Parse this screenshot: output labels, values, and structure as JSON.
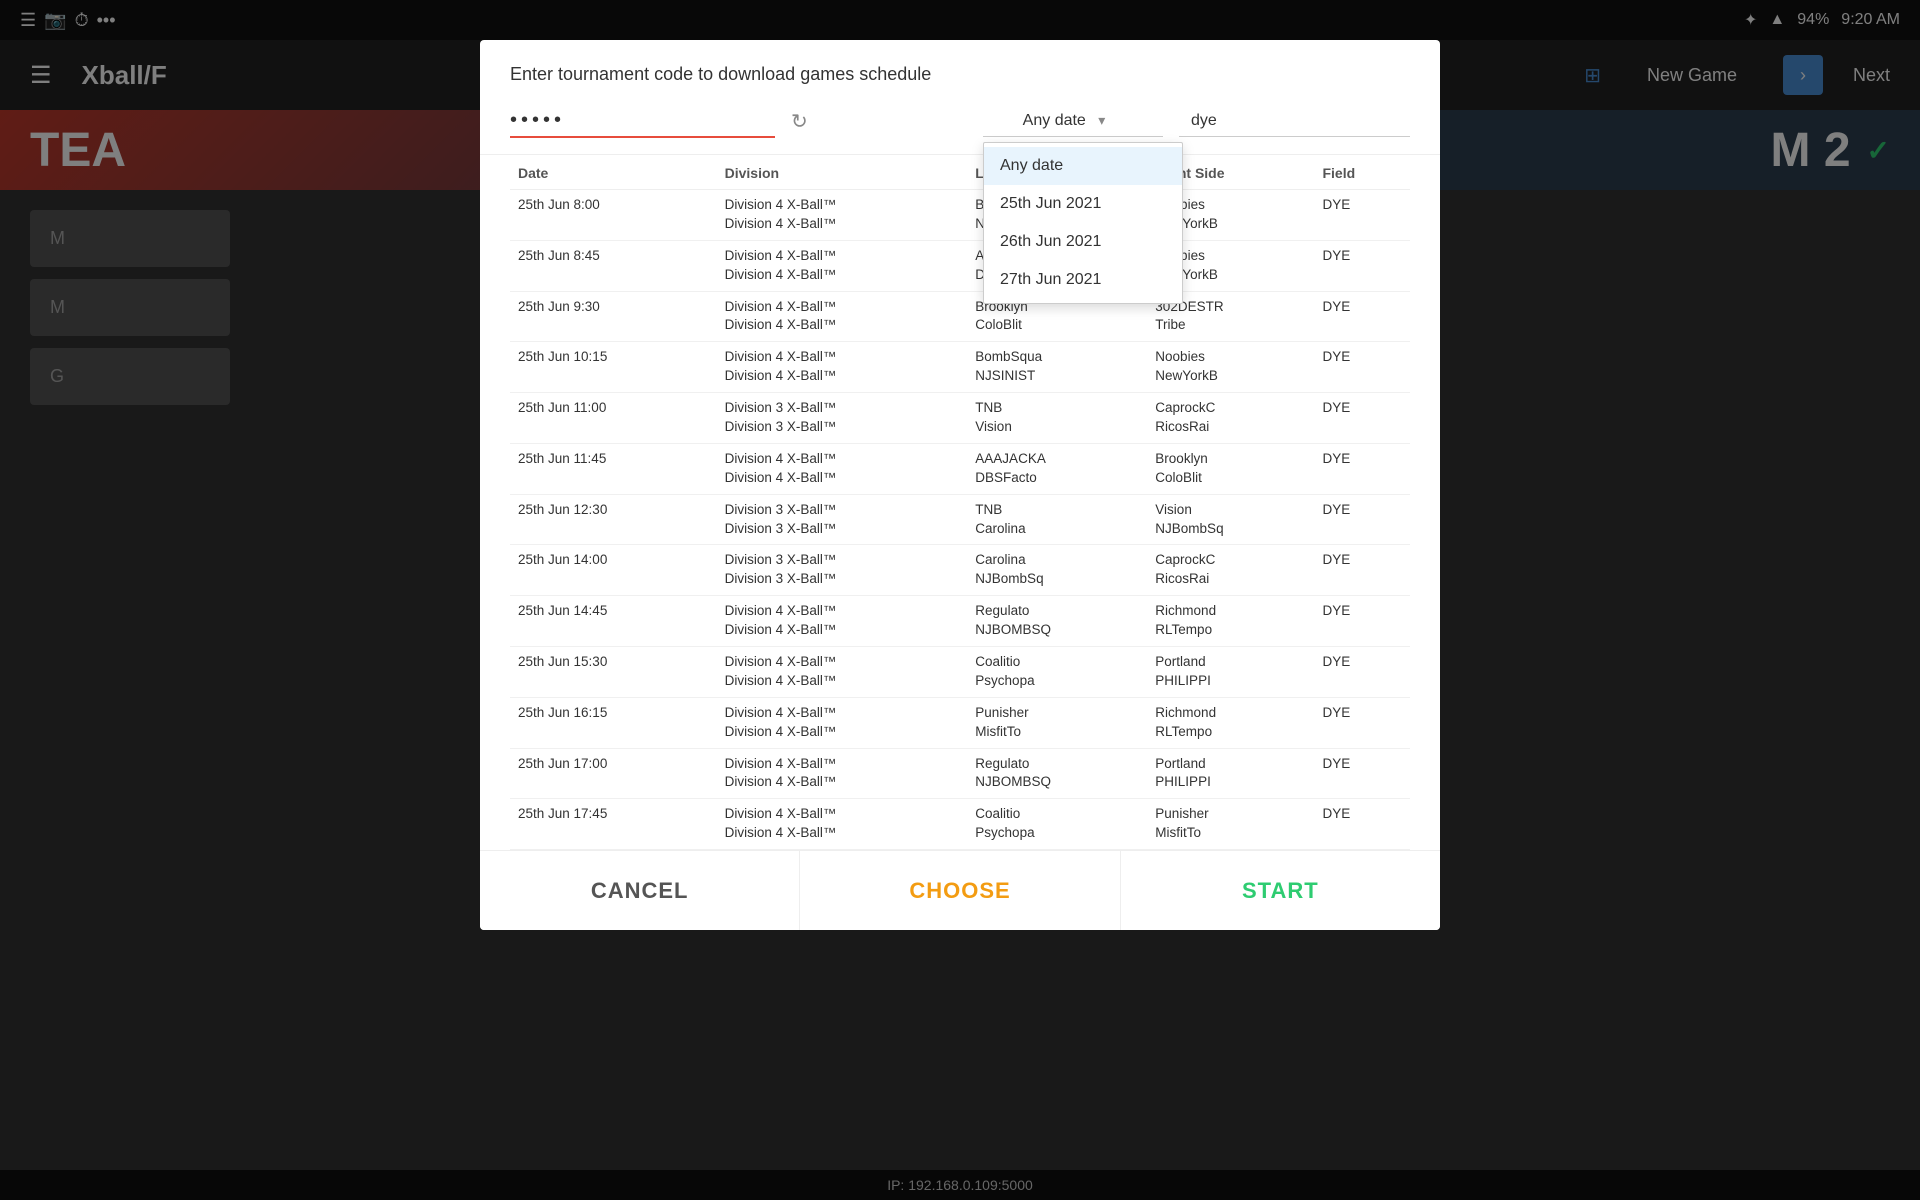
{
  "statusBar": {
    "leftIcons": [
      "☰",
      "📷",
      "⏱",
      "•••"
    ],
    "time": "9:20 AM",
    "battery": "94%",
    "wifi": "WiFi",
    "bluetooth": "BT"
  },
  "header": {
    "title": "Xball/F",
    "newGameLabel": "New Game",
    "nextLabel": "Next"
  },
  "teamBanner": {
    "text": "TEA"
  },
  "modal": {
    "title": "Enter tournament code to download games schedule",
    "codeValue": "•••••",
    "datePlaceholder": "Any date",
    "fieldSearchValue": "dye",
    "dateOptions": [
      "Any date",
      "25th Jun 2021",
      "26th Jun 2021",
      "27th Jun 2021"
    ],
    "selectedDate": "Any date",
    "columns": {
      "date": "Date",
      "division": "Division",
      "leftSide": "Left Side",
      "rightSide": "Right Side",
      "field": "Field"
    },
    "rows": [
      {
        "date": "25th Jun 8:00",
        "div1": "Division 4 X-Ball™",
        "div2": "Division 4 X-Ball™",
        "left1": "BombSqua",
        "left2": "NJSINIST",
        "right1": "Noobies",
        "right2": "NewYorkB",
        "field": "DYE"
      },
      {
        "date": "25th Jun 8:45",
        "div1": "Division 4 X-Ball™",
        "div2": "Division 4 X-Ball™",
        "left1": "AAAJACKA",
        "left2": "DBSFacto",
        "right1": "Noobies",
        "right2": "NewYorkB",
        "field": "DYE"
      },
      {
        "date": "25th Jun 9:30",
        "div1": "Division 4 X-Ball™",
        "div2": "Division 4 X-Ball™",
        "left1": "Brooklyn",
        "left2": "ColoBlit",
        "right1": "302DESTR",
        "right2": "Tribe",
        "field": "DYE"
      },
      {
        "date": "25th Jun 10:15",
        "div1": "Division 4 X-Ball™",
        "div2": "Division 4 X-Ball™",
        "left1": "BombSqua",
        "left2": "NJSINIST",
        "right1": "Noobies",
        "right2": "NewYorkB",
        "field": "DYE"
      },
      {
        "date": "25th Jun 11:00",
        "div1": "Division 3 X-Ball™",
        "div2": "Division 3 X-Ball™",
        "left1": "TNB",
        "left2": "Vision",
        "right1": "CaprockC",
        "right2": "RicosRai",
        "field": "DYE"
      },
      {
        "date": "25th Jun 11:45",
        "div1": "Division 4 X-Ball™",
        "div2": "Division 4 X-Ball™",
        "left1": "AAAJACKA",
        "left2": "DBSFacto",
        "right1": "Brooklyn",
        "right2": "ColoBlit",
        "field": "DYE"
      },
      {
        "date": "25th Jun 12:30",
        "div1": "Division 3 X-Ball™",
        "div2": "Division 3 X-Ball™",
        "left1": "TNB",
        "left2": "Carolina",
        "right1": "Vision",
        "right2": "NJBombSq",
        "field": "DYE"
      },
      {
        "date": "25th Jun 14:00",
        "div1": "Division 3 X-Ball™",
        "div2": "Division 3 X-Ball™",
        "left1": "Carolina",
        "left2": "NJBombSq",
        "right1": "CaprockC",
        "right2": "RicosRai",
        "field": "DYE"
      },
      {
        "date": "25th Jun 14:45",
        "div1": "Division 4 X-Ball™",
        "div2": "Division 4 X-Ball™",
        "left1": "Regulato",
        "left2": "NJBOMBSQ",
        "right1": "Richmond",
        "right2": "RLTempo",
        "field": "DYE"
      },
      {
        "date": "25th Jun 15:30",
        "div1": "Division 4 X-Ball™",
        "div2": "Division 4 X-Ball™",
        "left1": "Coalitio",
        "left2": "Psychopa",
        "right1": "Portland",
        "right2": "PHILIPPI",
        "field": "DYE"
      },
      {
        "date": "25th Jun 16:15",
        "div1": "Division 4 X-Ball™",
        "div2": "Division 4 X-Ball™",
        "left1": "Punisher",
        "left2": "MisfitTo",
        "right1": "Richmond",
        "right2": "RLTempo",
        "field": "DYE"
      },
      {
        "date": "25th Jun 17:00",
        "div1": "Division 4 X-Ball™",
        "div2": "Division 4 X-Ball™",
        "left1": "Regulato",
        "left2": "NJBOMBSQ",
        "right1": "Portland",
        "right2": "PHILIPPI",
        "field": "DYE"
      },
      {
        "date": "25th Jun 17:45",
        "div1": "Division 4 X-Ball™",
        "div2": "Division 4 X-Ball™",
        "left1": "Coalitio",
        "left2": "Psychopa",
        "right1": "Punisher",
        "right2": "MisfitTo",
        "field": "DYE"
      }
    ],
    "footer": {
      "cancelLabel": "CANCEL",
      "chooseLabel": "CHOOSE",
      "startLabel": "START"
    }
  },
  "ipBar": {
    "text": "IP: 192.168.0.109:5000"
  }
}
